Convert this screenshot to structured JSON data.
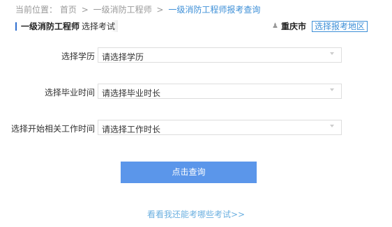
{
  "breadcrumb": {
    "prefix": "当前位置：",
    "items": [
      "首页",
      "一级消防工程师",
      "一级消防工程师报考查询"
    ],
    "separator": ">"
  },
  "header": {
    "title": "一级消防工程师",
    "exam_select": "选择考试",
    "city": "重庆市",
    "region_button": "选择报考地区"
  },
  "form": {
    "fields": [
      {
        "label": "选择学历",
        "value": "请选择学历"
      },
      {
        "label": "选择毕业时间",
        "value": "请选择毕业时长"
      },
      {
        "label": "选择开始相关工作时间",
        "value": "请选择工作时长"
      }
    ],
    "submit_label": "点击查询"
  },
  "footer": {
    "more_link": "看看我还能考哪些考试>>"
  },
  "colors": {
    "accent": "#3d8fd7",
    "button": "#5b96ea",
    "link": "#6cb0e0"
  },
  "icons": {
    "location": "user-pin-icon",
    "dropdown": "chevron-down-icon"
  }
}
